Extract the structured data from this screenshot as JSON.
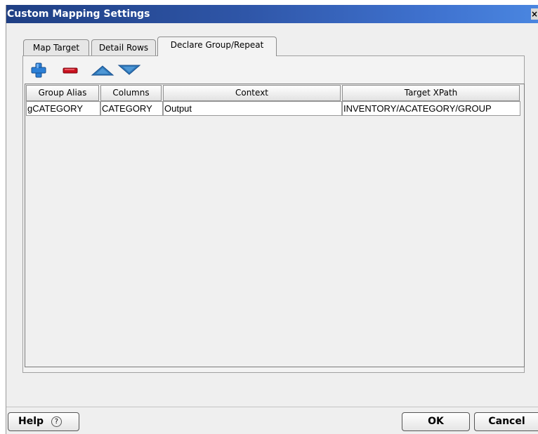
{
  "window": {
    "title": "Custom Mapping Settings",
    "close_glyph": "×"
  },
  "tabs": [
    {
      "label": "Map Target",
      "active": false
    },
    {
      "label": "Detail Rows",
      "active": false
    },
    {
      "label": "Declare Group/Repeat",
      "active": true
    }
  ],
  "toolbar": {
    "icons": [
      "add-icon",
      "remove-icon",
      "move-up-icon",
      "move-down-icon"
    ]
  },
  "table": {
    "columns": [
      "Group Alias",
      "Columns",
      "Context",
      "Target XPath"
    ],
    "rows": [
      [
        "gCATEGORY",
        "CATEGORY",
        "Output",
        "INVENTORY/ACATEGORY/GROUP"
      ]
    ]
  },
  "footer": {
    "help_label": "Help",
    "help_glyph": "?",
    "ok_label": "OK",
    "cancel_label": "Cancel"
  },
  "colors": {
    "title_bar": "#2f56a8",
    "add_icon": "#2b7fd6",
    "remove_icon": "#c8101d",
    "arrow_icon": "#2f78b8"
  }
}
